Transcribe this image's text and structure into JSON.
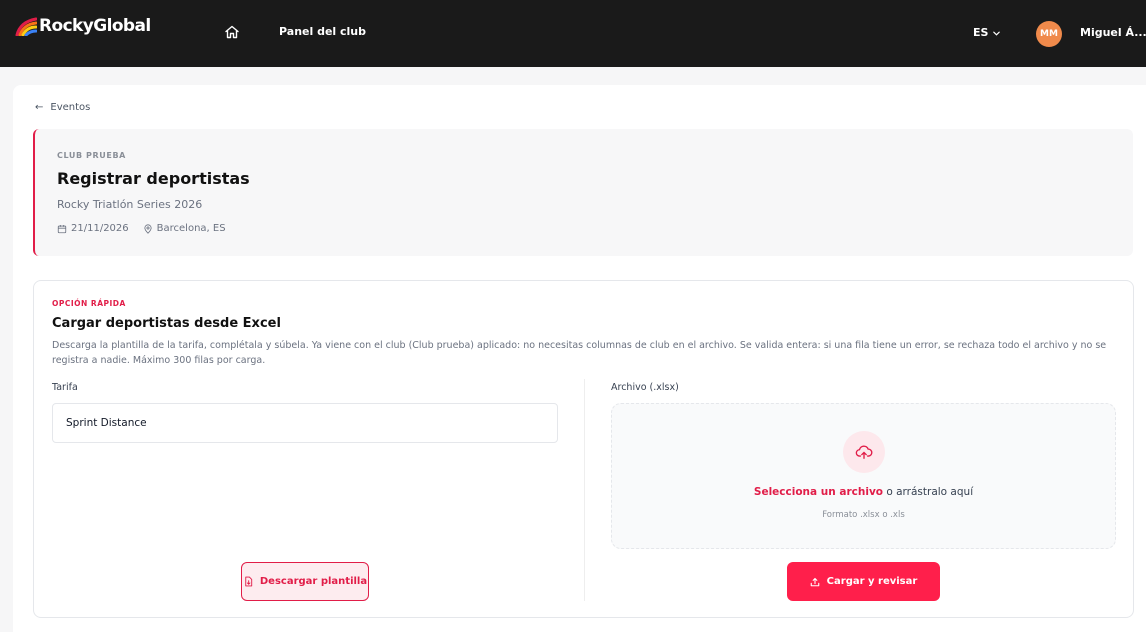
{
  "header": {
    "brand": "RockyGlobal",
    "nav_panel": "Panel del club",
    "language": "ES",
    "avatar_initials": "MM",
    "user_name": "Miguel Á..."
  },
  "breadcrumb": {
    "back_label": "Eventos"
  },
  "event": {
    "club": "CLUB PRUEBA",
    "title": "Registrar deportistas",
    "name": "Rocky Triatlón Series 2026",
    "date": "21/11/2026",
    "location": "Barcelona, ES"
  },
  "upload": {
    "kicker": "OPCIÓN RÁPIDA",
    "title": "Cargar deportistas desde Excel",
    "description": "Descarga la plantilla de la tarifa, complétala y súbela. Ya viene con el club (Club prueba) aplicado: no necesitas columnas de club en el archivo. Se valida entera: si una fila tiene un error, se rechaza todo el archivo y no se registra a nadie. Máximo 300 filas por carga.",
    "tarifa_label": "Tarifa",
    "tarifa_value": "Sprint Distance",
    "archivo_label": "Archivo (.xlsx)",
    "drop_select": "Selecciona un archivo",
    "drop_rest": " o arrástralo aquí",
    "drop_hint": "Formato .xlsx o .xls",
    "download_button": "Descargar plantilla",
    "submit_button": "Cargar y revisar"
  },
  "colors": {
    "accent": "#e11d48",
    "primary_button": "#ff1f4b",
    "topbar": "#1a1a1a",
    "avatar": "#f08a4b"
  },
  "icons": {
    "home": "home-icon",
    "language": "chevron-down-icon",
    "back": "arrow-left-icon",
    "date": "calendar-icon",
    "location": "map-pin-icon",
    "upload": "cloud-upload-icon",
    "template": "file-download-icon",
    "submit": "upload-icon"
  }
}
